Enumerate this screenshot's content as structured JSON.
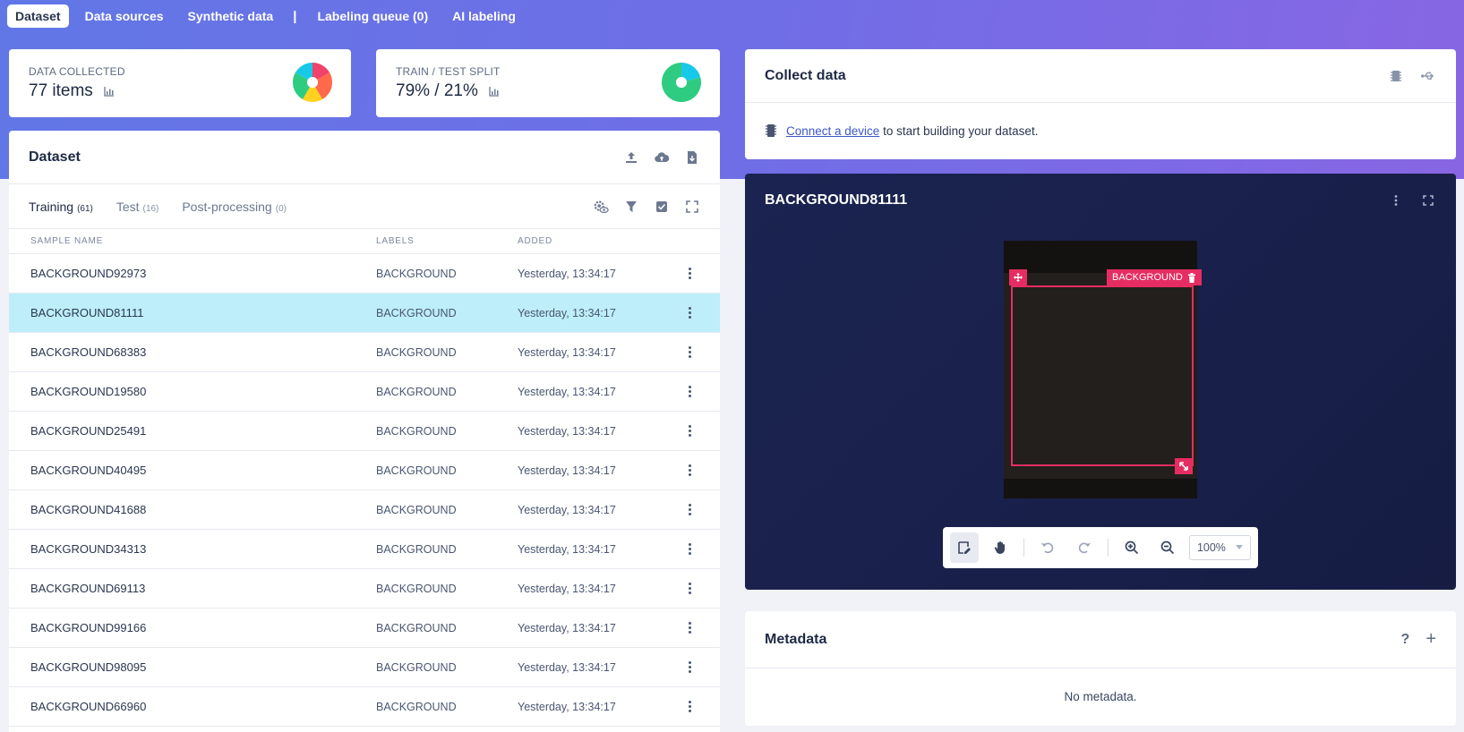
{
  "nav": {
    "tabs": [
      {
        "label": "Dataset",
        "active": true
      },
      {
        "label": "Data sources"
      },
      {
        "label": "Synthetic data"
      },
      {
        "label": "Labeling queue (0)"
      },
      {
        "label": "AI labeling"
      }
    ],
    "separator": "|"
  },
  "stats": {
    "collected": {
      "label": "DATA COLLECTED",
      "value": "77 items"
    },
    "split": {
      "label": "TRAIN / TEST SPLIT",
      "value": "79% / 21%",
      "train_fraction": 0.79,
      "test_fraction": 0.21
    }
  },
  "colors": {
    "accent_red": "#e62d62",
    "selected_row": "#bdeefa",
    "train": "#2ecc80",
    "test": "#18c8e8"
  },
  "dataset": {
    "title": "Dataset",
    "header_icons": [
      "upload-icon",
      "cloud-upload-icon",
      "download-icon"
    ],
    "tabs": [
      {
        "label": "Training",
        "count": "(61)",
        "active": true
      },
      {
        "label": "Test",
        "count": "(16)"
      },
      {
        "label": "Post-processing",
        "count": "(0)"
      }
    ],
    "tab_icons": [
      "settings-eye-icon",
      "filter-icon",
      "checkbox-icon",
      "expand-icon"
    ],
    "columns": {
      "name": "SAMPLE NAME",
      "labels": "LABELS",
      "added": "ADDED"
    },
    "rows": [
      {
        "name": "BACKGROUND92973",
        "label": "BACKGROUND",
        "added": "Yesterday, 13:34:17"
      },
      {
        "name": "BACKGROUND81111",
        "label": "BACKGROUND",
        "added": "Yesterday, 13:34:17",
        "selected": true
      },
      {
        "name": "BACKGROUND68383",
        "label": "BACKGROUND",
        "added": "Yesterday, 13:34:17"
      },
      {
        "name": "BACKGROUND19580",
        "label": "BACKGROUND",
        "added": "Yesterday, 13:34:17"
      },
      {
        "name": "BACKGROUND25491",
        "label": "BACKGROUND",
        "added": "Yesterday, 13:34:17"
      },
      {
        "name": "BACKGROUND40495",
        "label": "BACKGROUND",
        "added": "Yesterday, 13:34:17"
      },
      {
        "name": "BACKGROUND41688",
        "label": "BACKGROUND",
        "added": "Yesterday, 13:34:17"
      },
      {
        "name": "BACKGROUND34313",
        "label": "BACKGROUND",
        "added": "Yesterday, 13:34:17"
      },
      {
        "name": "BACKGROUND69113",
        "label": "BACKGROUND",
        "added": "Yesterday, 13:34:17"
      },
      {
        "name": "BACKGROUND99166",
        "label": "BACKGROUND",
        "added": "Yesterday, 13:34:17"
      },
      {
        "name": "BACKGROUND98095",
        "label": "BACKGROUND",
        "added": "Yesterday, 13:34:17"
      },
      {
        "name": "BACKGROUND66960",
        "label": "BACKGROUND",
        "added": "Yesterday, 13:34:17"
      }
    ]
  },
  "collect": {
    "title": "Collect data",
    "link_text": "Connect a device",
    "rest_text": "to start building your dataset."
  },
  "viewer": {
    "title": "BACKGROUND81111",
    "bbox_label": "BACKGROUND",
    "zoom": "100%"
  },
  "metadata": {
    "title": "Metadata",
    "help": "?",
    "add": "+",
    "empty": "No metadata."
  }
}
